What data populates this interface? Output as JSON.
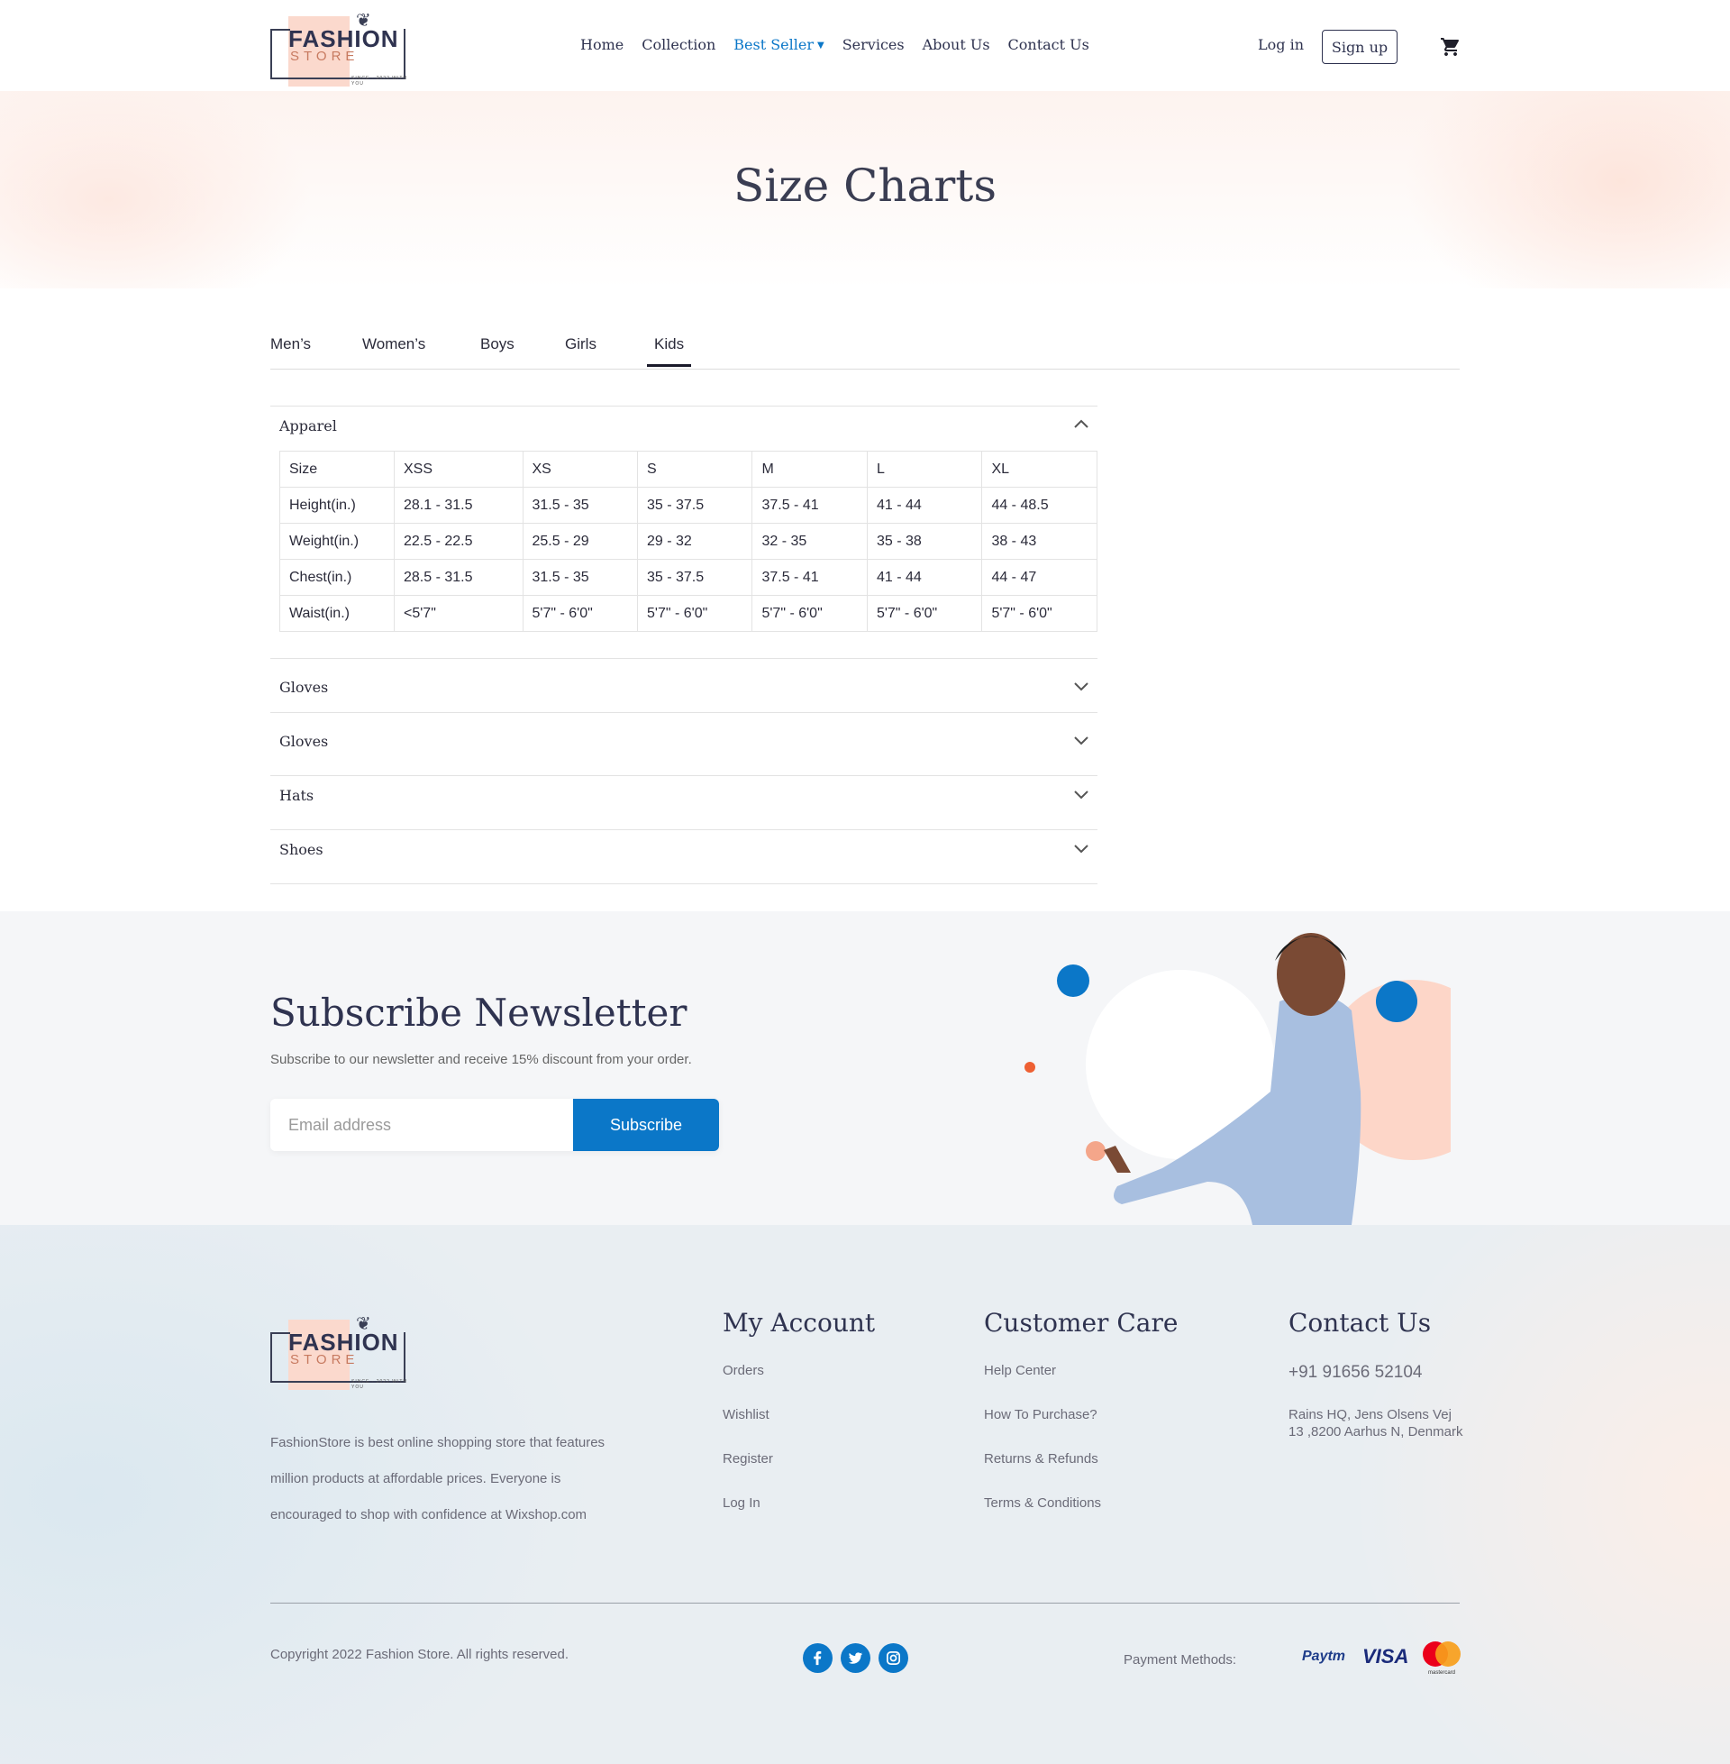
{
  "header": {
    "logo_word": "FASHION",
    "logo_sub": "STORE",
    "logo_tag": "SINCE · 2022 WITH YOU",
    "nav": [
      "Home",
      "Collection",
      "Best Seller",
      "Services",
      "About Us",
      "Contact Us"
    ],
    "login": "Log in",
    "signup": "Sign up"
  },
  "hero": {
    "title": "Size Charts"
  },
  "tabs": [
    "Men’s",
    "Women’s",
    "Boys",
    "Girls",
    "Kids"
  ],
  "active_tab": "Kids",
  "accordion": {
    "open_section": "Apparel",
    "table": {
      "header": [
        "Size",
        "XSS",
        "XS",
        "S",
        "M",
        "L",
        "XL"
      ],
      "rows": [
        [
          "Height(in.)",
          "28.1 - 31.5",
          "31.5 - 35",
          "35 - 37.5",
          "37.5 - 41",
          "41 - 44",
          "44 - 48.5"
        ],
        [
          "Weight(in.)",
          "22.5 - 22.5",
          "25.5 - 29",
          "29 - 32",
          "32 - 35",
          "35 - 38",
          "38 - 43"
        ],
        [
          "Chest(in.)",
          "28.5 - 31.5",
          "31.5 - 35",
          "35 - 37.5",
          "37.5 - 41",
          "41 - 44",
          "44 - 47"
        ],
        [
          "Waist(in.)",
          "<5'7\"",
          "5'7\" - 6'0\"",
          "5'7\" - 6'0\"",
          "5'7\" - 6'0\"",
          "5'7\" - 6'0\"",
          "5'7\" - 6'0\""
        ]
      ]
    },
    "collapsed": [
      "Gloves",
      "Gloves",
      "Hats",
      "Shoes"
    ]
  },
  "newsletter": {
    "title": "Subscribe Newsletter",
    "text": "Subscribe to our newsletter and receive 15% discount from your order.",
    "placeholder": "Email address",
    "button": "Subscribe"
  },
  "footer": {
    "description": "FashionStore is best online shopping store that features million products at affordable prices. Everyone is encouraged to shop with confidence at Wixshop.com",
    "my_account": {
      "title": "My Account",
      "links": [
        "Orders",
        "Wishlist",
        "Register",
        "Log In"
      ]
    },
    "customer_care": {
      "title": "Customer Care",
      "links": [
        "Help Center",
        "How To Purchase?",
        "Returns & Refunds",
        "Terms & Conditions"
      ]
    },
    "contact": {
      "title": "Contact Us",
      "phone": "+91 91656 52104",
      "address": "Rains HQ, Jens Olsens Vej 13 ,8200 Aarhus N, Denmark"
    },
    "copyright": "Copyright 2022 Fashion Store. All rights reserved.",
    "payment_label": "Payment Methods:",
    "payments": [
      "Paytm",
      "VISA",
      "mastercard"
    ]
  },
  "colors": {
    "accent": "#0b77c8",
    "dark": "#2f3350",
    "peach": "#fbd9cd"
  }
}
